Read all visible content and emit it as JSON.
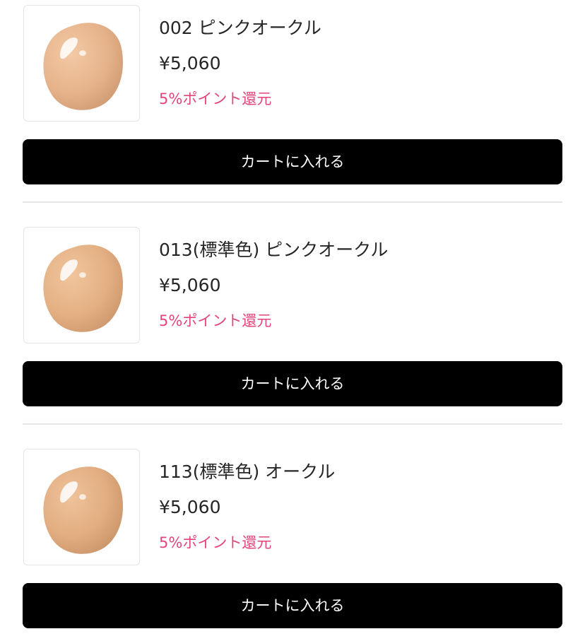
{
  "products": [
    {
      "name": "002 ピンクオークル",
      "price": "¥5,060",
      "points": "5%ポイント還元",
      "cart_label": "カートに入れる",
      "swatch_color": "#e7b48d"
    },
    {
      "name": "013(標準色) ピンクオークル",
      "price": "¥5,060",
      "points": "5%ポイント還元",
      "cart_label": "カートに入れる",
      "swatch_color": "#e5b184"
    },
    {
      "name": "113(標準色) オークル",
      "price": "¥5,060",
      "points": "5%ポイント還元",
      "cart_label": "カートに入れる",
      "swatch_color": "#e3ae82"
    }
  ],
  "colors": {
    "points_accent": "#e2457a",
    "button_bg": "#000000",
    "button_text": "#ffffff",
    "divider": "#e6e6e6"
  }
}
